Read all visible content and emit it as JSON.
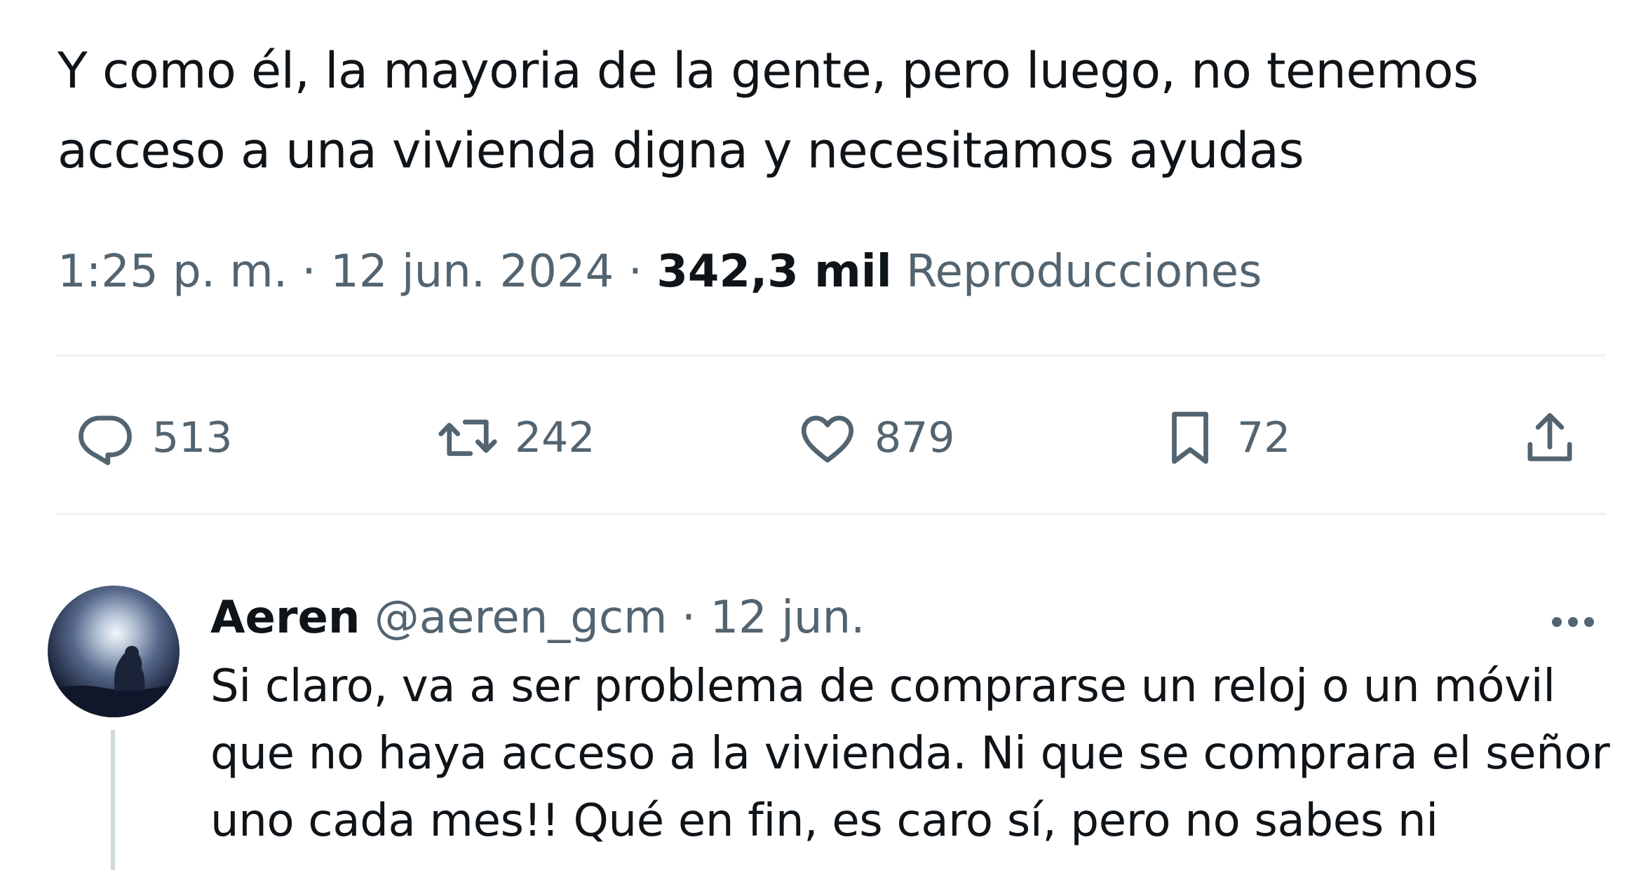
{
  "tweet": {
    "text": "Y como él, la mayoria de la gente, pero luego, no tenemos acceso a una vivienda digna y necesitamos ayudas",
    "time": "1:25 p. m.",
    "separator": "·",
    "date": "12 jun. 2024",
    "views_count": "342,3 mil",
    "views_label": "Reproducciones"
  },
  "actions": {
    "replies": "513",
    "reposts": "242",
    "likes": "879",
    "bookmarks": "72"
  },
  "reply": {
    "name": "Aeren",
    "handle": "@aeren_gcm",
    "separator": "·",
    "date": "12 jun.",
    "text": "Si claro, va a ser problema de comprarse un reloj o un móvil que no haya acceso a la vivienda. Ni que se comprara el señor uno cada mes!! Qué en fin, es caro sí, pero no sabes ni"
  },
  "colors": {
    "text_primary": "#0f1419",
    "text_secondary": "#536471",
    "divider": "#eff3f4",
    "thread_line": "#cfd9de"
  }
}
